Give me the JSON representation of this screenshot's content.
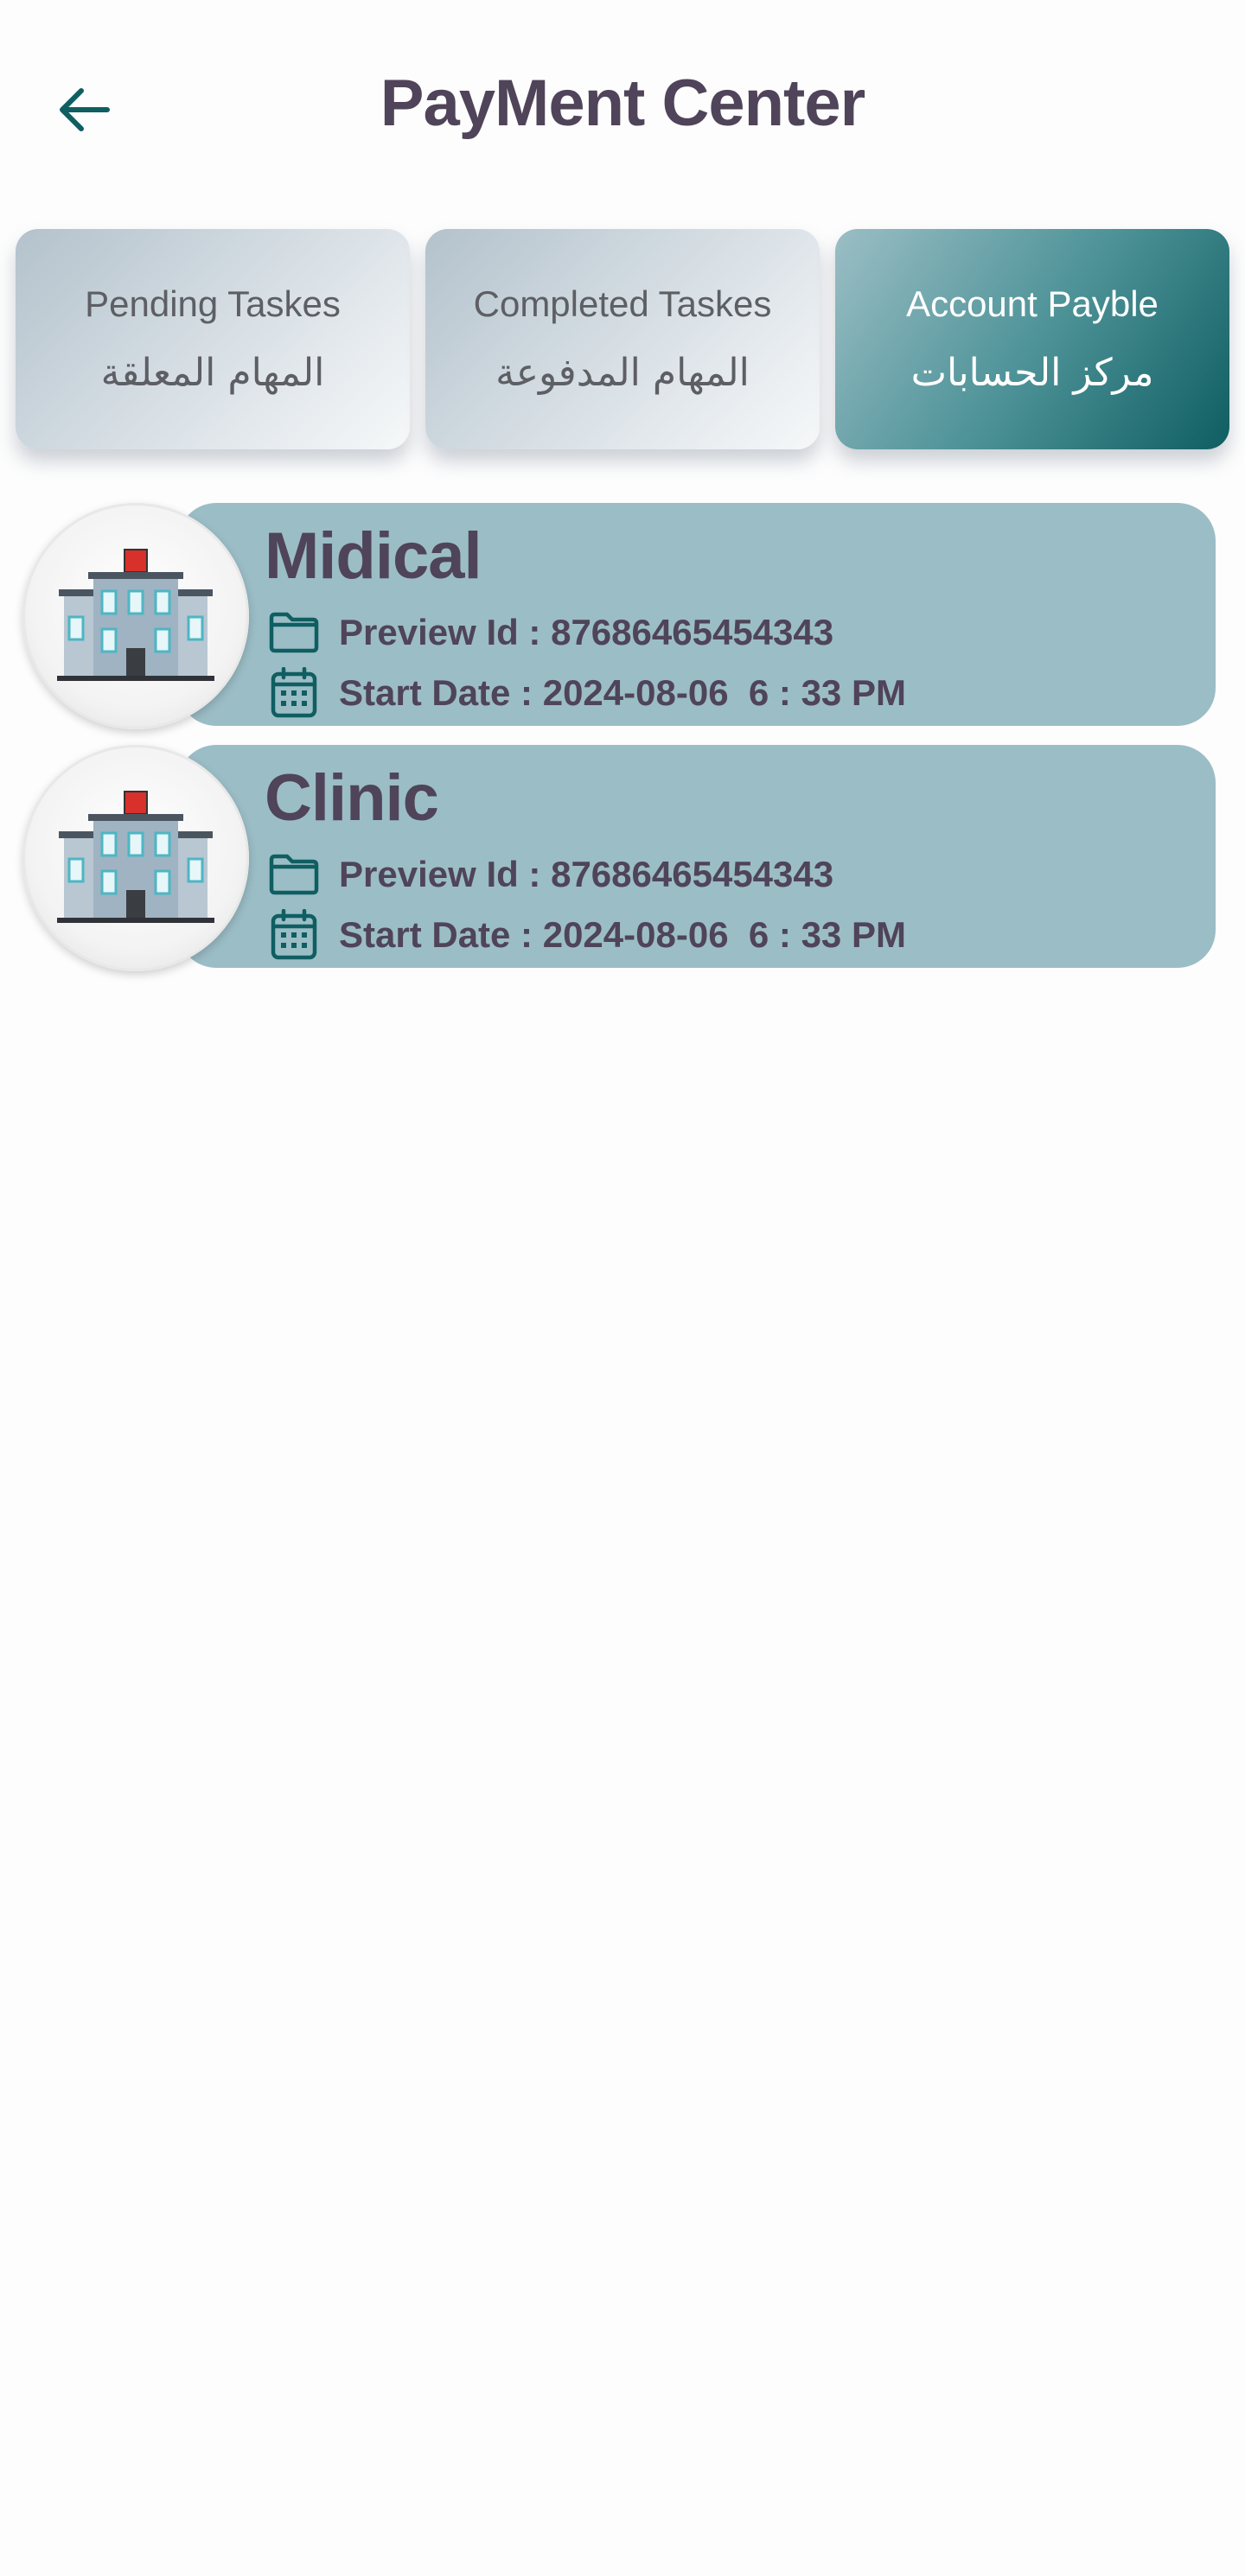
{
  "header": {
    "title": "PayMent Center"
  },
  "tabs": [
    {
      "label_en": "Pending Taskes",
      "label_ar": "المهام المعلقة",
      "active": false
    },
    {
      "label_en": "Completed Taskes",
      "label_ar": "المهام المدفوعة",
      "active": false
    },
    {
      "label_en": "Account Payble",
      "label_ar": "مركز الحسابات",
      "active": true
    }
  ],
  "cards": [
    {
      "title": "Midical",
      "preview_id": "Preview Id : 87686465454343",
      "start_date": "Start Date : 2024-08-06  6 : 33 PM"
    },
    {
      "title": "Clinic",
      "preview_id": "Preview Id : 87686465454343",
      "start_date": "Start Date : 2024-08-06  6 : 33 PM"
    }
  ],
  "colors": {
    "primary": "#0f5e62",
    "card_background": "#9bbdc6",
    "title_text": "#4f4459"
  },
  "icons": {
    "back": "arrow-left-icon",
    "preview": "folder-icon",
    "date": "calendar-icon",
    "avatar": "hospital-building-icon"
  }
}
